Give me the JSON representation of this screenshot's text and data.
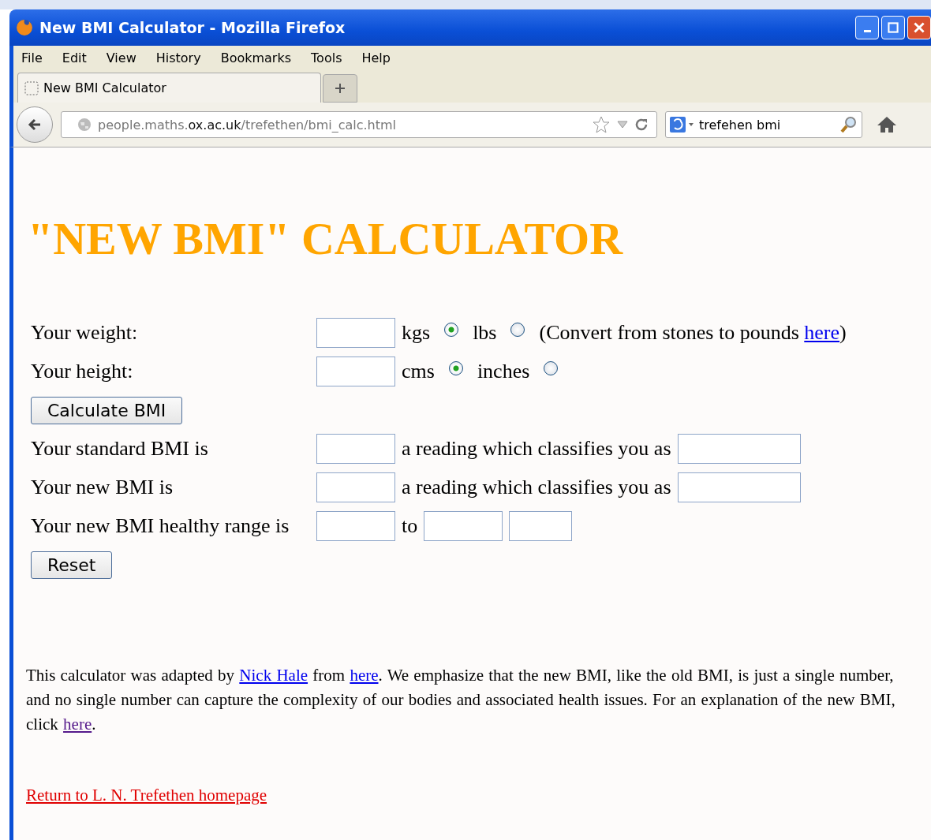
{
  "window": {
    "title": "New BMI Calculator - Mozilla Firefox"
  },
  "menu": [
    {
      "label": "File"
    },
    {
      "label": "Edit"
    },
    {
      "label": "View"
    },
    {
      "label": "History"
    },
    {
      "label": "Bookmarks"
    },
    {
      "label": "Tools"
    },
    {
      "label": "Help"
    }
  ],
  "tabs": [
    {
      "label": "New BMI Calculator",
      "selected": true
    }
  ],
  "url": {
    "prefix": "people.maths.",
    "domain": "ox.ac.uk",
    "path": "/trefethen/bmi_calc.html"
  },
  "search": {
    "value": "trefehen bmi"
  },
  "page": {
    "heading": "\"NEW BMI\" CALCULATOR",
    "rows": [
      {
        "kind": "units",
        "label": "Your weight:",
        "units": [
          {
            "label": "kgs",
            "selected": true
          },
          {
            "label": "lbs",
            "selected": false
          }
        ],
        "note_before": "(Convert from stones to pounds ",
        "note_link": "here",
        "note_after": ")"
      },
      {
        "kind": "units",
        "label": "Your height:",
        "units": [
          {
            "label": "cms",
            "selected": true
          },
          {
            "label": "inches",
            "selected": false
          }
        ]
      },
      {
        "kind": "button",
        "label": "Calculate BMI"
      },
      {
        "kind": "result",
        "label": "Your standard BMI is",
        "middle": "a reading which classifies you as"
      },
      {
        "kind": "result",
        "label": "Your new BMI is",
        "middle": "a reading which classifies you as"
      },
      {
        "kind": "range",
        "label": "Your new BMI healthy range is",
        "middle": "to"
      },
      {
        "kind": "button",
        "label": "Reset"
      }
    ],
    "paragraph": [
      {
        "text": "This calculator was adapted by "
      },
      {
        "link": "Nick Hale",
        "visited": false
      },
      {
        "text": " from "
      },
      {
        "link": "here",
        "visited": false
      },
      {
        "text": ". We emphasize that the new BMI, like the old BMI, is just a single number, and no single number can capture the complexity of our bodies and associated health issues. For an explanation of the new BMI, click "
      },
      {
        "link": "here",
        "visited": true
      },
      {
        "text": "."
      }
    ],
    "return_link": "Return to L. N. Trefethen homepage"
  }
}
